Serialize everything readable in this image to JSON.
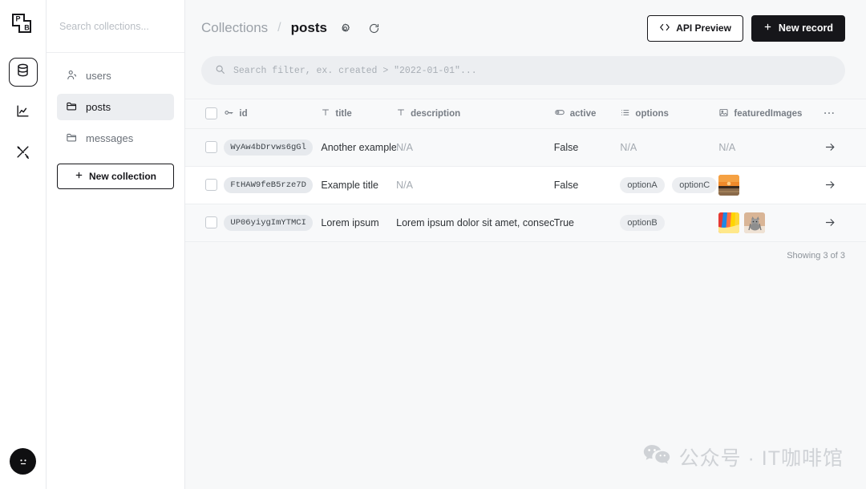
{
  "brand": {
    "logo_text_top": "P",
    "logo_text_bottom": "B"
  },
  "rail": {
    "items": [
      {
        "icon": "database-icon",
        "label": "Collections",
        "active": true
      },
      {
        "icon": "chart-logs-icon",
        "label": "Logs",
        "active": false
      },
      {
        "icon": "tools-settings-icon",
        "label": "Settings",
        "active": false
      }
    ],
    "avatar_label": "Account"
  },
  "sidebar": {
    "search_placeholder": "Search collections...",
    "items": [
      {
        "label": "users",
        "icon": "users-icon",
        "active": false
      },
      {
        "label": "posts",
        "icon": "folder-icon",
        "active": true
      },
      {
        "label": "messages",
        "icon": "folder-icon",
        "active": false
      }
    ],
    "new_collection_label": "New collection"
  },
  "header": {
    "breadcrumb_root": "Collections",
    "breadcrumb_sep": "/",
    "breadcrumb_current": "posts",
    "settings_icon": "gear-icon",
    "refresh_icon": "refresh-icon",
    "api_preview_label": "API Preview",
    "new_record_label": "New record"
  },
  "filter": {
    "placeholder": "Search filter, ex. created > \"2022-01-01\"...",
    "value": ""
  },
  "table": {
    "columns": [
      {
        "key": "id",
        "label": "id",
        "icon": "key-icon"
      },
      {
        "key": "title",
        "label": "title",
        "icon": "text-icon"
      },
      {
        "key": "description",
        "label": "description",
        "icon": "text-icon"
      },
      {
        "key": "active",
        "label": "active",
        "icon": "toggle-icon"
      },
      {
        "key": "options",
        "label": "options",
        "icon": "list-icon"
      },
      {
        "key": "featuredImages",
        "label": "featuredImages",
        "icon": "image-icon"
      }
    ],
    "more_label": "···",
    "rows": [
      {
        "id": "WyAw4bDrvws6gGl",
        "title": "Another example",
        "description": "N/A",
        "active": "False",
        "options": [],
        "options_empty": "N/A",
        "images": [],
        "images_empty": "N/A"
      },
      {
        "id": "FtHAW9feB5rze7D",
        "title": "Example title",
        "description": "N/A",
        "active": "False",
        "options": [
          "optionA",
          "optionC"
        ],
        "options_empty": "",
        "images": [
          "sunset-beach-thumbnail"
        ],
        "images_empty": ""
      },
      {
        "id": "UP06yiygImYTMCI",
        "title": "Lorem ipsum",
        "description": "Lorem ipsum dolor sit amet, consec…",
        "active": "True",
        "options": [
          "optionB"
        ],
        "options_empty": "",
        "images": [
          "rainbow-thumbnail",
          "cat-thumbnail"
        ],
        "images_empty": ""
      }
    ],
    "showing": "Showing 3 of 3"
  },
  "watermark": {
    "text": "公众号 · IT咖啡馆",
    "icon": "wechat-icon"
  },
  "colors": {
    "accent": "#16161a",
    "row_alt": "#f8f9fa",
    "tag_bg": "#eceef1",
    "muted": "#a3a9b0"
  }
}
